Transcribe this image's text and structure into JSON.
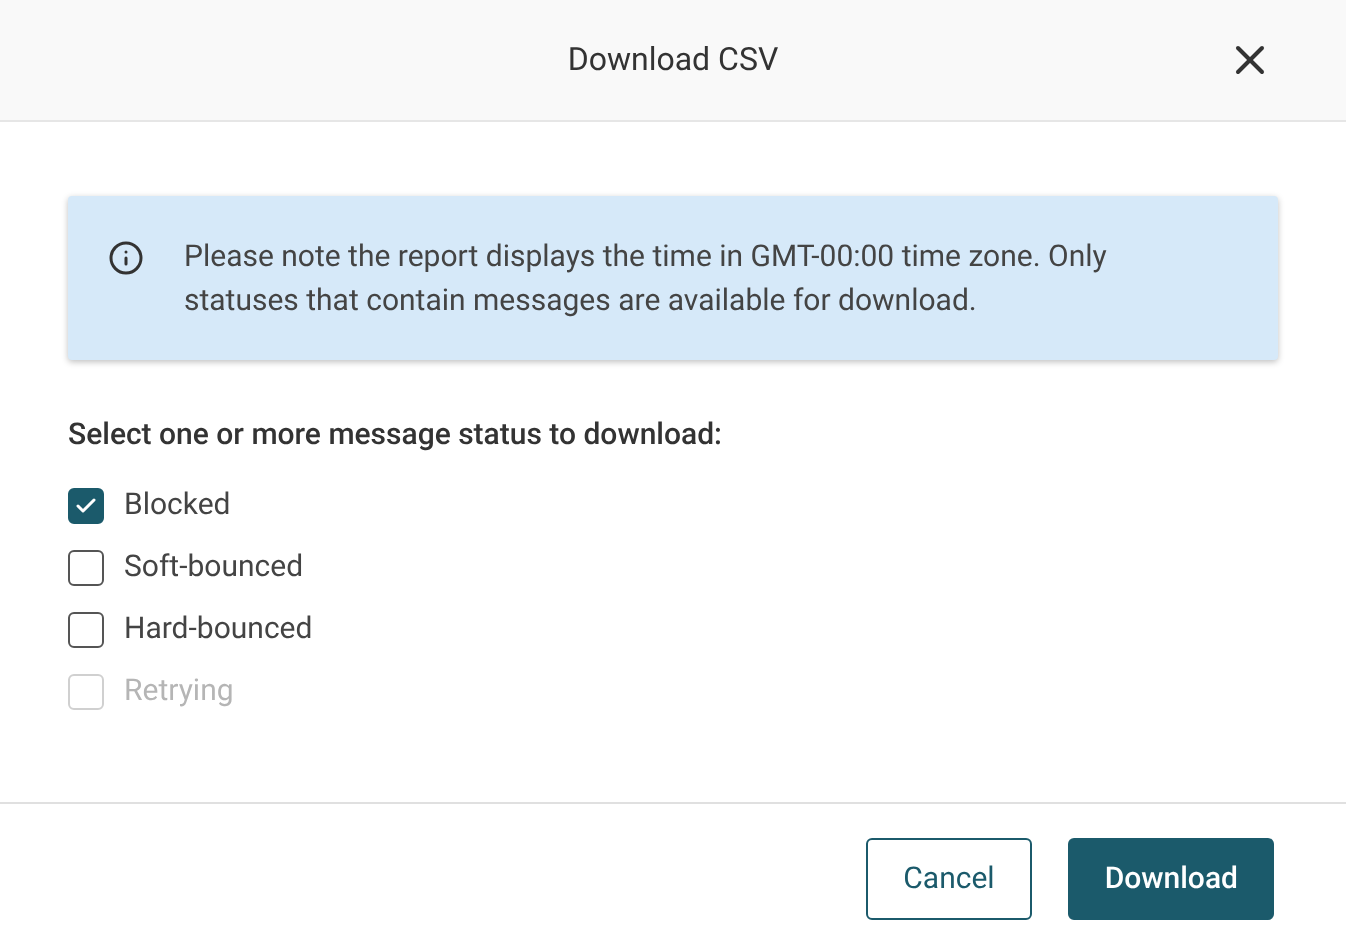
{
  "dialog": {
    "title": "Download CSV"
  },
  "notice": {
    "text": "Please note the report displays the time in GMT-00:00 time zone. Only statuses that contain messages are available for download."
  },
  "prompt": "Select one or more message status to download:",
  "statuses": [
    {
      "label": "Blocked",
      "checked": true,
      "disabled": false
    },
    {
      "label": "Soft-bounced",
      "checked": false,
      "disabled": false
    },
    {
      "label": "Hard-bounced",
      "checked": false,
      "disabled": false
    },
    {
      "label": "Retrying",
      "checked": false,
      "disabled": true
    }
  ],
  "buttons": [
    {
      "label": "Cancel",
      "kind": "secondary"
    },
    {
      "label": "Download",
      "kind": "primary"
    }
  ]
}
